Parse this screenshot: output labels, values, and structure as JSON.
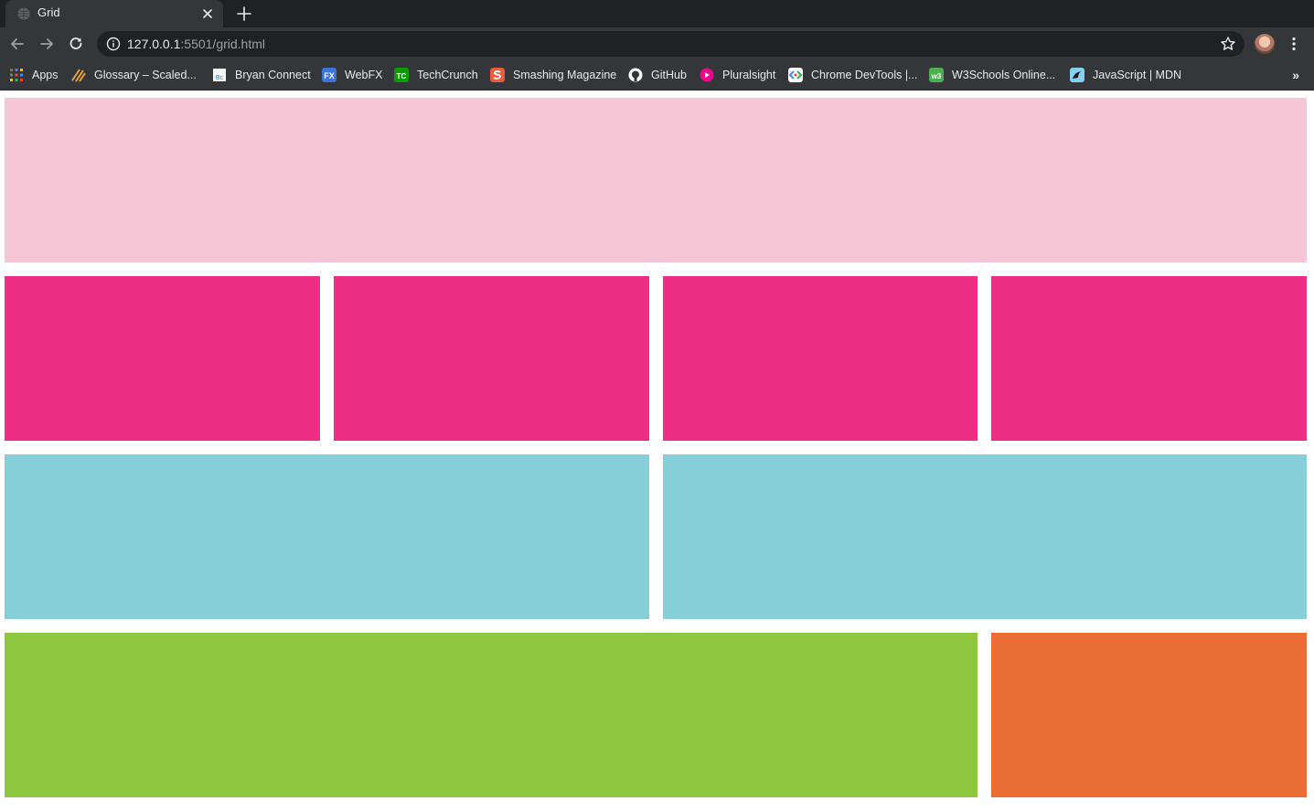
{
  "tab": {
    "title": "Grid"
  },
  "toolbar": {
    "url_host": "127.0.0.1",
    "url_rest": ":5501/grid.html"
  },
  "bookmarks": [
    {
      "label": "Apps",
      "icon": "apps-grid-icon",
      "color": "#ea4335"
    },
    {
      "label": "Glossary – Scaled...",
      "icon": "glossary-icon",
      "color": "#e3a33b"
    },
    {
      "label": "Bryan Connect",
      "icon": "bryan-connect-icon",
      "color": "#ffffff"
    },
    {
      "label": "WebFX",
      "icon": "webfx-icon",
      "color": "#3f74d6"
    },
    {
      "label": "TechCrunch",
      "icon": "techcrunch-icon",
      "color": "#0a9e01"
    },
    {
      "label": "Smashing Magazine",
      "icon": "smashing-magazine-icon",
      "color": "#e85c41"
    },
    {
      "label": "GitHub",
      "icon": "github-icon",
      "color": "#ffffff"
    },
    {
      "label": "Pluralsight",
      "icon": "pluralsight-icon",
      "color": "#f15b2a"
    },
    {
      "label": "Chrome DevTools |...",
      "icon": "chrome-devtools-icon",
      "color": "#ffffff"
    },
    {
      "label": "W3Schools Online...",
      "icon": "w3schools-icon",
      "color": "#4caf50"
    },
    {
      "label": "JavaScript | MDN",
      "icon": "mdn-icon",
      "color": "#83d0f2"
    }
  ],
  "grid_colors": {
    "pink_light": "#f5c6d6",
    "pink_hot": "#ee2e84",
    "blue": "#86ced8",
    "green": "#8ec73d",
    "orange": "#e86e35"
  }
}
